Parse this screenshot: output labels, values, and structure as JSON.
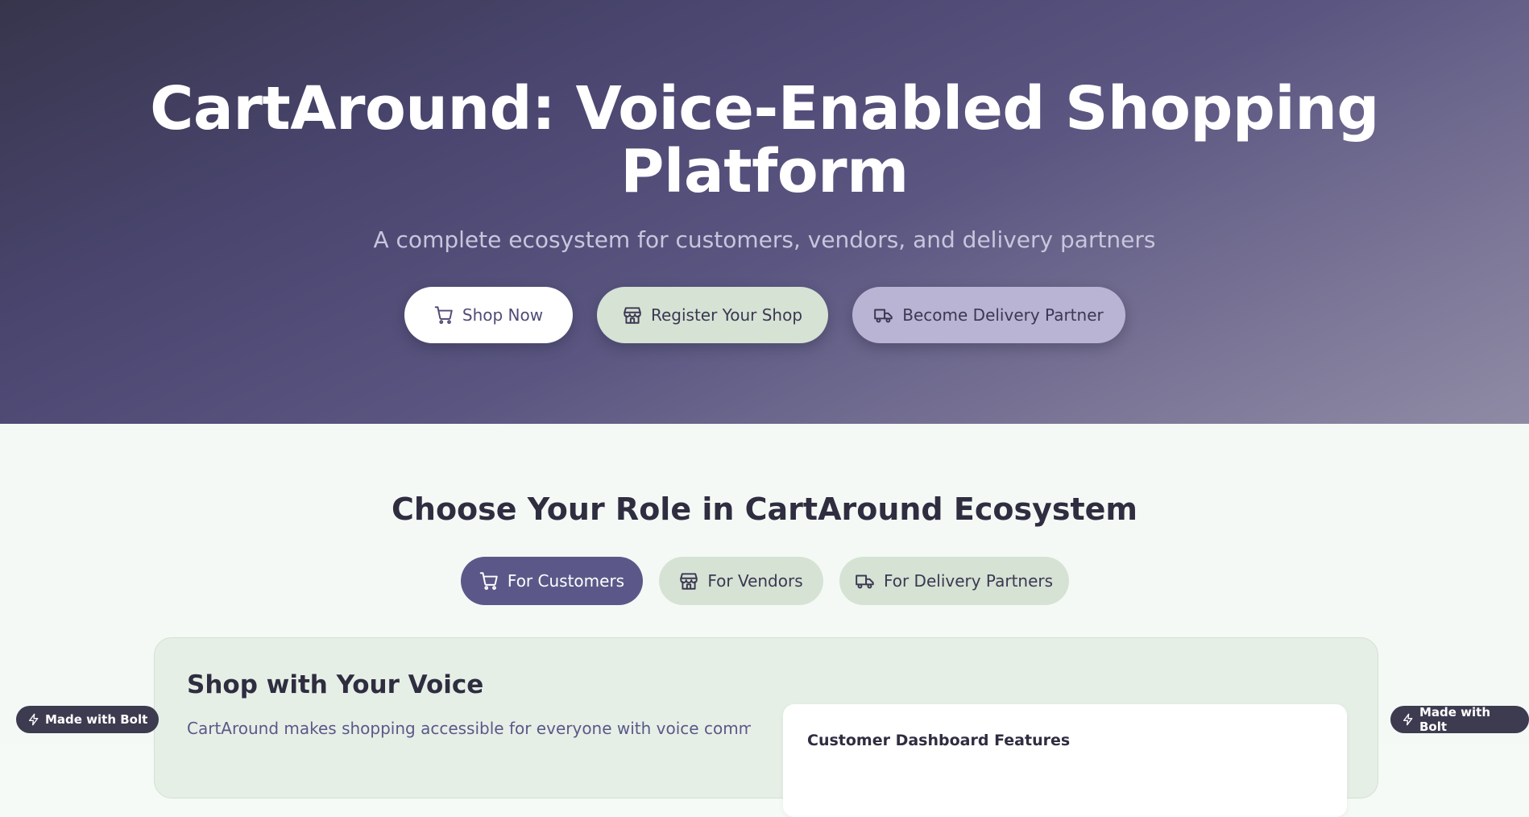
{
  "hero": {
    "title_line1": "CartAround: Voice-Enabled Shopping",
    "title_line2": "Platform",
    "subtitle": "A complete ecosystem for customers, vendors, and delivery partners",
    "buttons": {
      "shop": "Shop Now",
      "register": "Register Your Shop",
      "delivery": "Become Delivery Partner"
    }
  },
  "roles": {
    "title": "Choose Your Role in CartAround Ecosystem",
    "tabs": {
      "customers": "For Customers",
      "vendors": "For Vendors",
      "delivery": "For Delivery Partners"
    },
    "active_tab": "For Customers"
  },
  "panel": {
    "title": "Shop with Your Voice",
    "text": "CartAround makes shopping accessible for everyone with voice commands, AI-",
    "feature_card_title": "Customer Dashboard Features"
  },
  "badges": {
    "left": "Made with Bolt",
    "right": "Made with Bolt"
  },
  "icons": {
    "cart": "cart-icon",
    "store": "store-icon",
    "truck": "truck-icon",
    "bolt": "bolt-icon"
  },
  "colors": {
    "primary": "#5b5889",
    "secondary_button": "#d6e2d4",
    "delivery_button": "#b9b4d3",
    "hero_dark": "#37354c",
    "page_background": "#f4f9f5"
  }
}
